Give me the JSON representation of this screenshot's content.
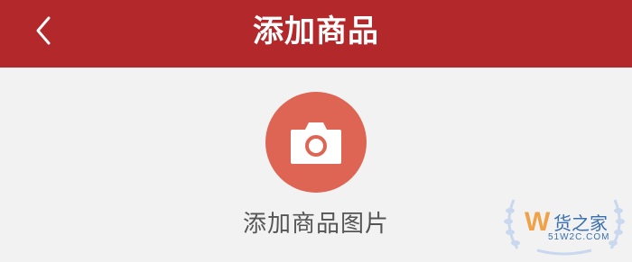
{
  "header": {
    "title": "添加商品",
    "back_icon": "chevron-left-icon",
    "background_color": "#b3282a"
  },
  "upload": {
    "icon": "camera-icon",
    "label": "添加商品图片",
    "circle_color": "#de6454"
  },
  "watermark": {
    "logo_letter": "W",
    "name": "货之家",
    "domain": "51W2C.COM"
  }
}
